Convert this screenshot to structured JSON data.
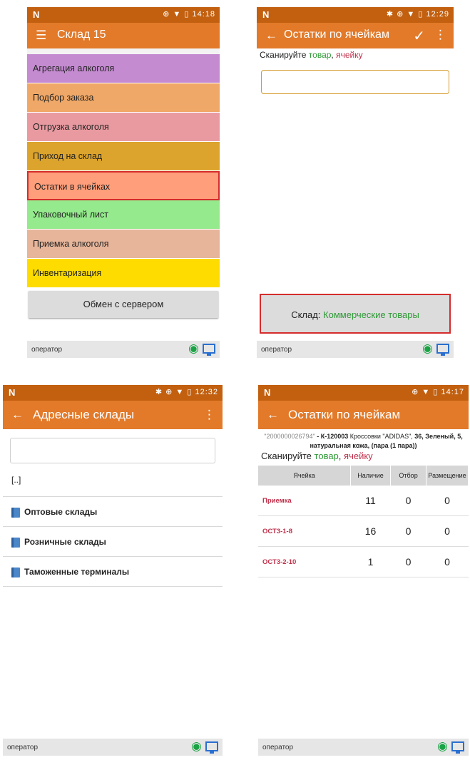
{
  "footer": {
    "operator": "оператор"
  },
  "icons": {
    "wifi": "wifi-icon",
    "monitor": "monitor-icon",
    "folder": "folder-icon"
  },
  "colors": {
    "statusbar": "#c2600f",
    "appbar": "#e27a2a",
    "green": "#2f9a37",
    "red": "#c0304a",
    "highlight": "#d52c2c"
  },
  "panel1": {
    "time": "14:18",
    "title": "Склад 15",
    "menu": [
      {
        "label": "Агрегация алкоголя",
        "color": "#c48bd0"
      },
      {
        "label": "Подбор заказа",
        "color": "#f0a868"
      },
      {
        "label": "Отгрузка алкоголя",
        "color": "#e89aa0"
      },
      {
        "label": "Приход на склад",
        "color": "#dca42c"
      },
      {
        "label": "Остатки в ячейках",
        "color": "#ff9e7a"
      },
      {
        "label": "Упаковочный лист",
        "color": "#94ea8c"
      },
      {
        "label": "Приемка алкоголя",
        "color": "#e6b59a"
      },
      {
        "label": "Инвентаризация",
        "color": "#fedc00"
      }
    ],
    "exchange_button": "Обмен с сервером"
  },
  "panel2": {
    "time": "12:29",
    "title": "Остатки по ячейкам",
    "prompt_prefix": "Сканируйте ",
    "prompt_goods": "товар",
    "prompt_sep": ", ",
    "prompt_cell": "ячейку",
    "warehouse_label": "Склад: ",
    "warehouse_value": "Коммерческие товары"
  },
  "panel3": {
    "time": "12:32",
    "title": "Адресные склады",
    "parent": "[..]",
    "folders": [
      "Оптовые склады",
      "Розничные склады",
      "Таможенные терминалы"
    ]
  },
  "panel4": {
    "time": "14:17",
    "title": "Остатки по ячейкам",
    "product_code": "\"2000000026794\"",
    "product_sep": " - ",
    "product_article": "К-120003",
    "product_name": " Кроссовки \"ADIDAS\", ",
    "product_attrs": "36, Зеленый, 5, натуральная кожа, (пара (1 пара))",
    "prompt_prefix": "Сканируйте ",
    "prompt_goods": "товар",
    "prompt_sep": ", ",
    "prompt_cell": "ячейку",
    "columns": [
      "Ячейка",
      "Наличие",
      "Отбор",
      "Размещение"
    ],
    "rows": [
      {
        "cell": "Приемка",
        "stock": "11",
        "pick": "0",
        "place": "0"
      },
      {
        "cell": "ОСТ3-1-8",
        "stock": "16",
        "pick": "0",
        "place": "0"
      },
      {
        "cell": "ОСТ3-2-10",
        "stock": "1",
        "pick": "0",
        "place": "0"
      }
    ]
  }
}
